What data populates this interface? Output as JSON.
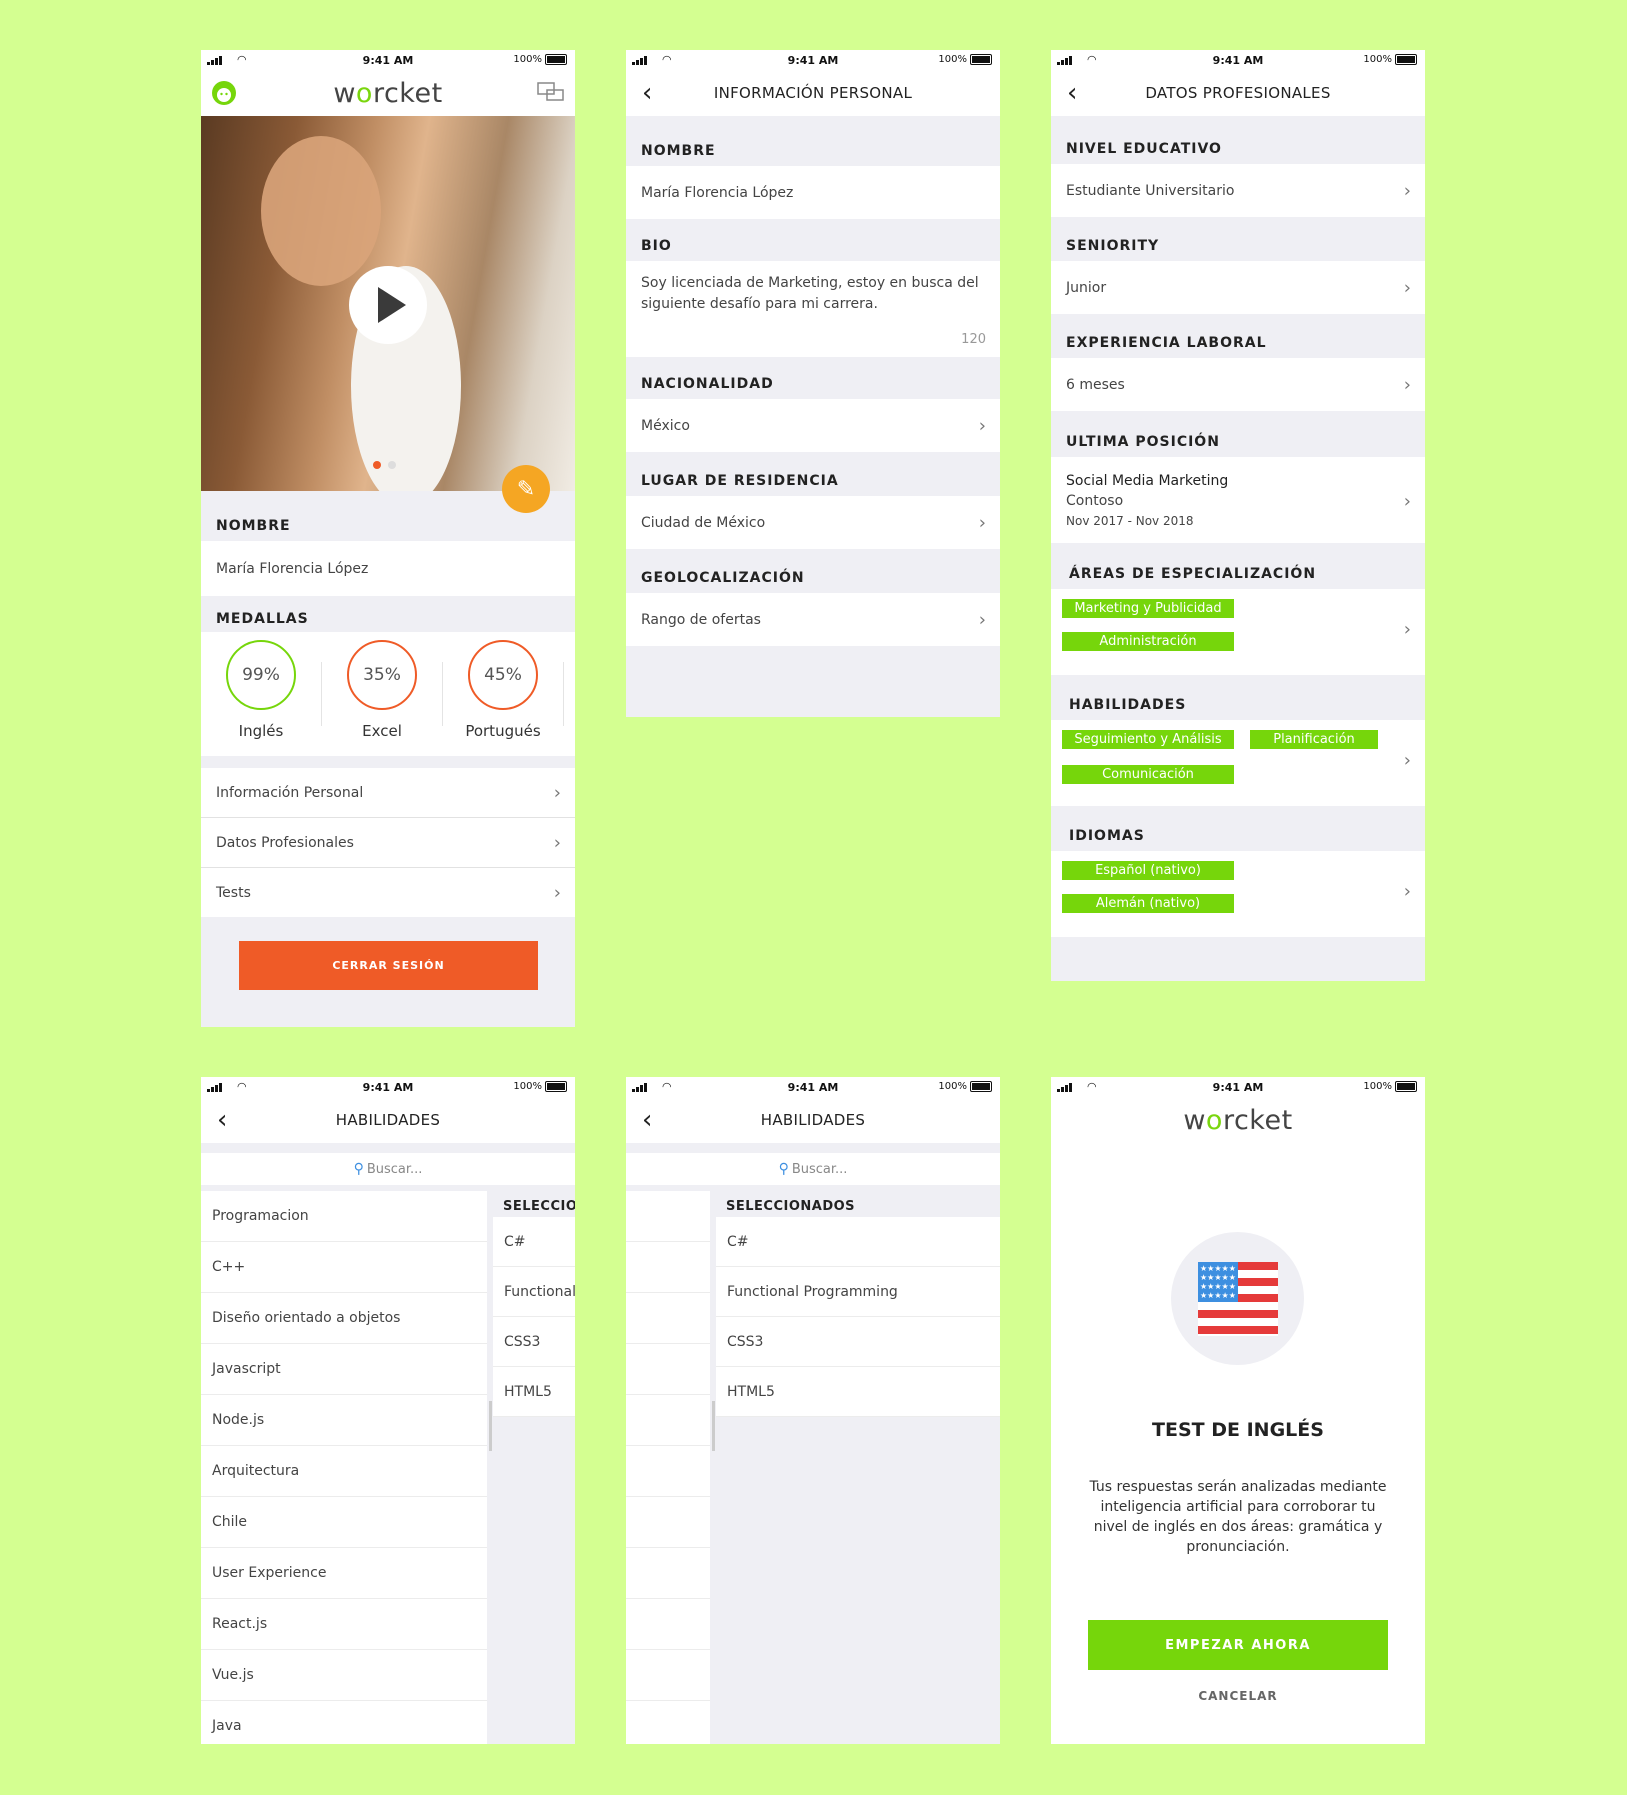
{
  "status": {
    "time": "9:41 AM",
    "battery": "100%"
  },
  "brand": {
    "logo_pre": "w",
    "logo_o": "o",
    "logo_post": "rcket",
    "accent": "#76d60b",
    "orange": "#ef5b27"
  },
  "profile": {
    "nombre_label": "NOMBRE",
    "nombre": "María Florencia López",
    "medallas_label": "MEDALLAS",
    "medals": [
      {
        "value": "99%",
        "label": "Inglés",
        "color": "#76d60b"
      },
      {
        "value": "35%",
        "label": "Excel",
        "color": "#ef5b27"
      },
      {
        "value": "45%",
        "label": "Portugués",
        "color": "#ef5b27"
      }
    ],
    "menu": [
      "Información Personal",
      "Datos Profesionales",
      "Tests"
    ],
    "logout": "CERRAR SESIÓN"
  },
  "personal": {
    "title": "INFORMACIÓN PERSONAL",
    "nombre_label": "NOMBRE",
    "nombre": "María Florencia López",
    "bio_label": "BIO",
    "bio": "Soy licenciada de Marketing, estoy en busca del siguiente desafío para mi carrera.",
    "bio_count": "120",
    "nac_label": "NACIONALIDAD",
    "nac": "México",
    "res_label": "LUGAR DE RESIDENCIA",
    "res": "Ciudad de México",
    "geo_label": "GEOLOCALIZACIÓN",
    "geo": "Rango de ofertas"
  },
  "profesional": {
    "title": "DATOS PROFESIONALES",
    "nivel_label": "NIVEL EDUCATIVO",
    "nivel": "Estudiante Universitario",
    "sen_label": "SENIORITY",
    "sen": "Junior",
    "exp_label": "EXPERIENCIA LABORAL",
    "exp": "6 meses",
    "pos_label": "ULTIMA POSICIÓN",
    "pos_title": "Social Media Marketing",
    "pos_company": "Contoso",
    "pos_dates": "Nov 2017 - Nov 2018",
    "areas_label": "ÁREAS DE ESPECIALIZACIÓN",
    "areas": [
      "Marketing y Publicidad",
      "Administración"
    ],
    "hab_label": "HABILIDADES",
    "habilidades": [
      "Seguimiento y Análisis",
      "Planificación",
      "Comunicación"
    ],
    "idi_label": "IDIOMAS",
    "idiomas": [
      "Español (nativo)",
      "Alemán (nativo)"
    ]
  },
  "skills": {
    "title": "HABILIDADES",
    "search_placeholder": "Buscar...",
    "list": [
      "Programacion",
      "C++",
      "Diseño orientado a objetos",
      "Javascript",
      "Node.js",
      "Arquitectura",
      "Chile",
      "User Experience",
      "React.js",
      "Vue.js",
      "Java"
    ],
    "selected_label": "SELECCIONADOS",
    "selected": [
      "C#",
      "Functional Programming",
      "CSS3",
      "HTML5"
    ]
  },
  "test": {
    "title": "TEST DE INGLÉS",
    "desc": "Tus respuestas serán analizadas mediante inteligencia artificial para corroborar tu nivel de inglés en dos áreas: gramática y pronunciación.",
    "start": "EMPEZAR AHORA",
    "cancel": "CANCELAR"
  }
}
